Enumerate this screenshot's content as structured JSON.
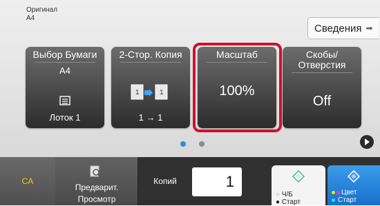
{
  "original": {
    "label": "Оригинал",
    "size": "A4"
  },
  "details_button": {
    "label": "Сведения"
  },
  "tiles": [
    {
      "title": "Выбор Бумаги",
      "sub": "A4",
      "bottom": "Лоток 1"
    },
    {
      "title": "2-Стор. Копия",
      "bottom": "1 → 1"
    },
    {
      "title": "Масштаб",
      "value": "100%"
    },
    {
      "title": "Скобы/Отверстия",
      "value": "Off"
    }
  ],
  "pager": {
    "page_count": 2,
    "current_page": 1
  },
  "bottom": {
    "ca_label": "CA",
    "preview_label": "Предварит. Просмотр",
    "copies_label": "Копий",
    "copies_value": "1",
    "bw_start": {
      "line1": "Ч/Б",
      "line2": "Старт"
    },
    "color_start": {
      "line1": "Цвет",
      "line2": "Старт"
    }
  },
  "colors": {
    "highlight": "#d0102b",
    "accent_blue": "#2e8be6",
    "ca_yellow": "#f3c51c",
    "start_icon": "#5bbf9b"
  },
  "icons": [
    "paper-tray-icon",
    "duplex-copy-icon",
    "arrow-right-icon",
    "preview-magnifier-icon",
    "start-diamond-icon",
    "next-page-icon"
  ]
}
